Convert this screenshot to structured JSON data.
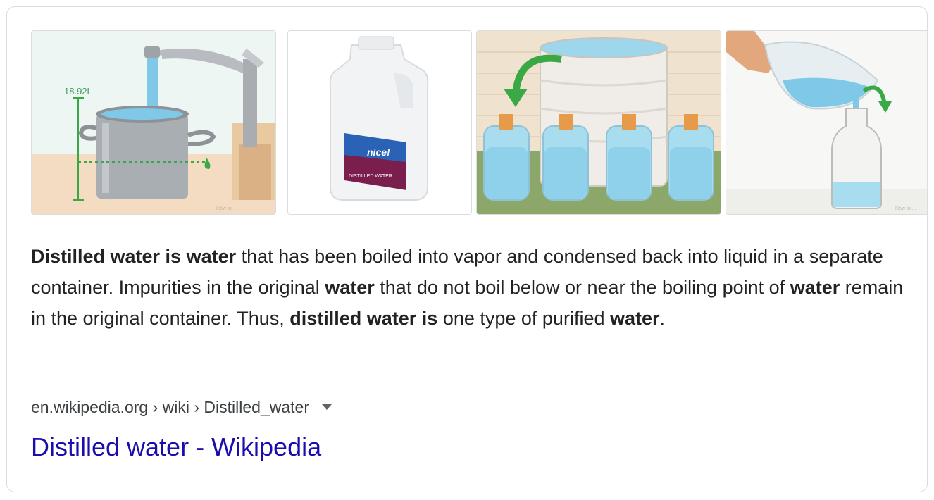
{
  "images": [
    {
      "label": "pot-under-faucet-image",
      "measure": "18.92L",
      "watermark": "How to ..."
    },
    {
      "label": "water-jug-image",
      "brand": "nice!",
      "product": "DISTILLED WATER"
    },
    {
      "label": "bottles-from-drum-image"
    },
    {
      "label": "pour-into-bottle-image",
      "watermark": "How to ..."
    }
  ],
  "snippet": {
    "parts": [
      {
        "text": "Distilled water is water",
        "bold": true
      },
      {
        "text": " that has been boiled into vapor and condensed back into liquid in a separate container. Impurities in the original ",
        "bold": false
      },
      {
        "text": "water",
        "bold": true
      },
      {
        "text": " that do not boil below or near the boiling point of ",
        "bold": false
      },
      {
        "text": "water",
        "bold": true
      },
      {
        "text": " remain in the original container. Thus, ",
        "bold": false
      },
      {
        "text": "distilled water is",
        "bold": true
      },
      {
        "text": " one type of purified ",
        "bold": false
      },
      {
        "text": "water",
        "bold": true
      },
      {
        "text": ".",
        "bold": false
      }
    ]
  },
  "result": {
    "breadcrumb": "en.wikipedia.org › wiki › Distilled_water",
    "title": "Distilled water - Wikipedia"
  },
  "colors": {
    "link": "#1a0dab",
    "text": "#222222",
    "breadcrumb": "#3c4043",
    "water": "#7fc8e8",
    "arrow": "#3aa845"
  }
}
